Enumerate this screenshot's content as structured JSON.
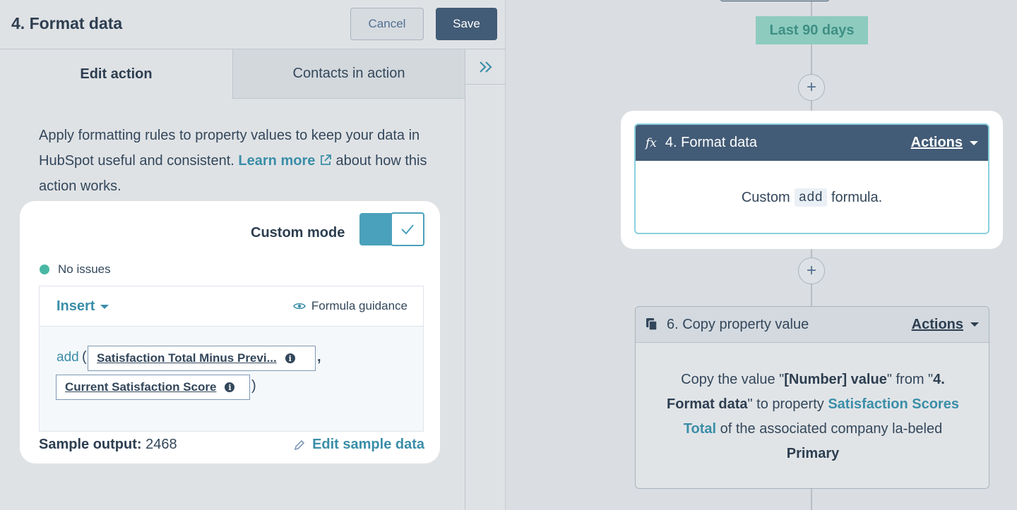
{
  "panel": {
    "title": "4. Format data",
    "cancel_label": "Cancel",
    "save_label": "Save",
    "tabs": [
      {
        "label": "Edit action",
        "active": true
      },
      {
        "label": "Contacts in action",
        "active": false
      }
    ],
    "collapse_icon": "double-chevron-right-icon",
    "description": {
      "text_before": "Apply formatting rules to property values to keep your data in HubSpot useful and consistent.",
      "link": "Learn more",
      "text_after": "about how this action works."
    }
  },
  "formula": {
    "custom_mode_label": "Custom mode",
    "custom_mode_on": true,
    "status": "No issues",
    "insert_label": "Insert",
    "guidance_label": "Formula guidance",
    "function_name": "add",
    "open_paren": "(",
    "close_paren": ")",
    "comma": ",",
    "args": [
      {
        "label": "Satisfaction Total Minus Previ..."
      },
      {
        "label": "Current Satisfaction Score"
      }
    ],
    "sample_output_label": "Sample output:",
    "sample_output_value": "2468",
    "edit_sample_label": "Edit sample data"
  },
  "canvas": {
    "date_pill": "Last 90 days",
    "plus_symbol": "+",
    "format_card": {
      "title": "4. Format data",
      "fx": "fx",
      "actions_label": "Actions",
      "body_before": "Custom",
      "body_code": "add",
      "body_after": "formula."
    },
    "copy_card": {
      "title": "6. Copy property value",
      "actions_label": "Actions",
      "t1": "Copy the value \"",
      "b1": "[Number] value",
      "t2": "\" from \"",
      "b2": "4. Format data",
      "t3": "\" to property",
      "link": "Satisfaction Scores Total",
      "t4": "of the associated company la-beled",
      "b3": "Primary"
    }
  },
  "colors": {
    "accent": "#3a8ea8",
    "header_dark": "#425b76",
    "status_green": "#48b8a4",
    "date_pill_bg": "#8ecbbf"
  }
}
